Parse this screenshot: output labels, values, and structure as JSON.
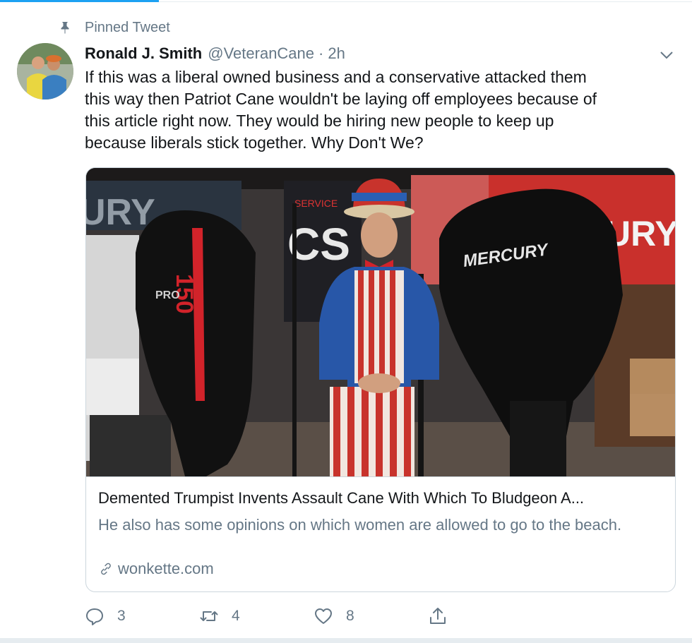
{
  "pinned": {
    "label": "Pinned Tweet"
  },
  "tweet": {
    "author_name": "Ronald J. Smith",
    "handle": "@VeteranCane",
    "separator": "·",
    "time": "2h",
    "text_lines": [
      "If this was a liberal owned business and a conservative attacked them",
      "this way then Patriot Cane wouldn't be laying off employees because of",
      "this article right now.  They would be hiring new people to keep up",
      "because liberals stick together. Why Don't We?"
    ]
  },
  "card": {
    "image_texts": [
      "MERCURY",
      "150",
      "PRO",
      "SERVICE",
      "CS",
      "URY"
    ],
    "title": "Demented Trumpist Invents Assault Cane With Which To Bludgeon A...",
    "description": "He also has some opinions on which women are allowed to go to the beach.",
    "domain": "wonkette.com"
  },
  "actions": {
    "reply_count": "3",
    "retweet_count": "4",
    "like_count": "8"
  },
  "colors": {
    "accent": "#1da1f2",
    "secondary_text": "#657786",
    "border": "#ccd6dd"
  }
}
